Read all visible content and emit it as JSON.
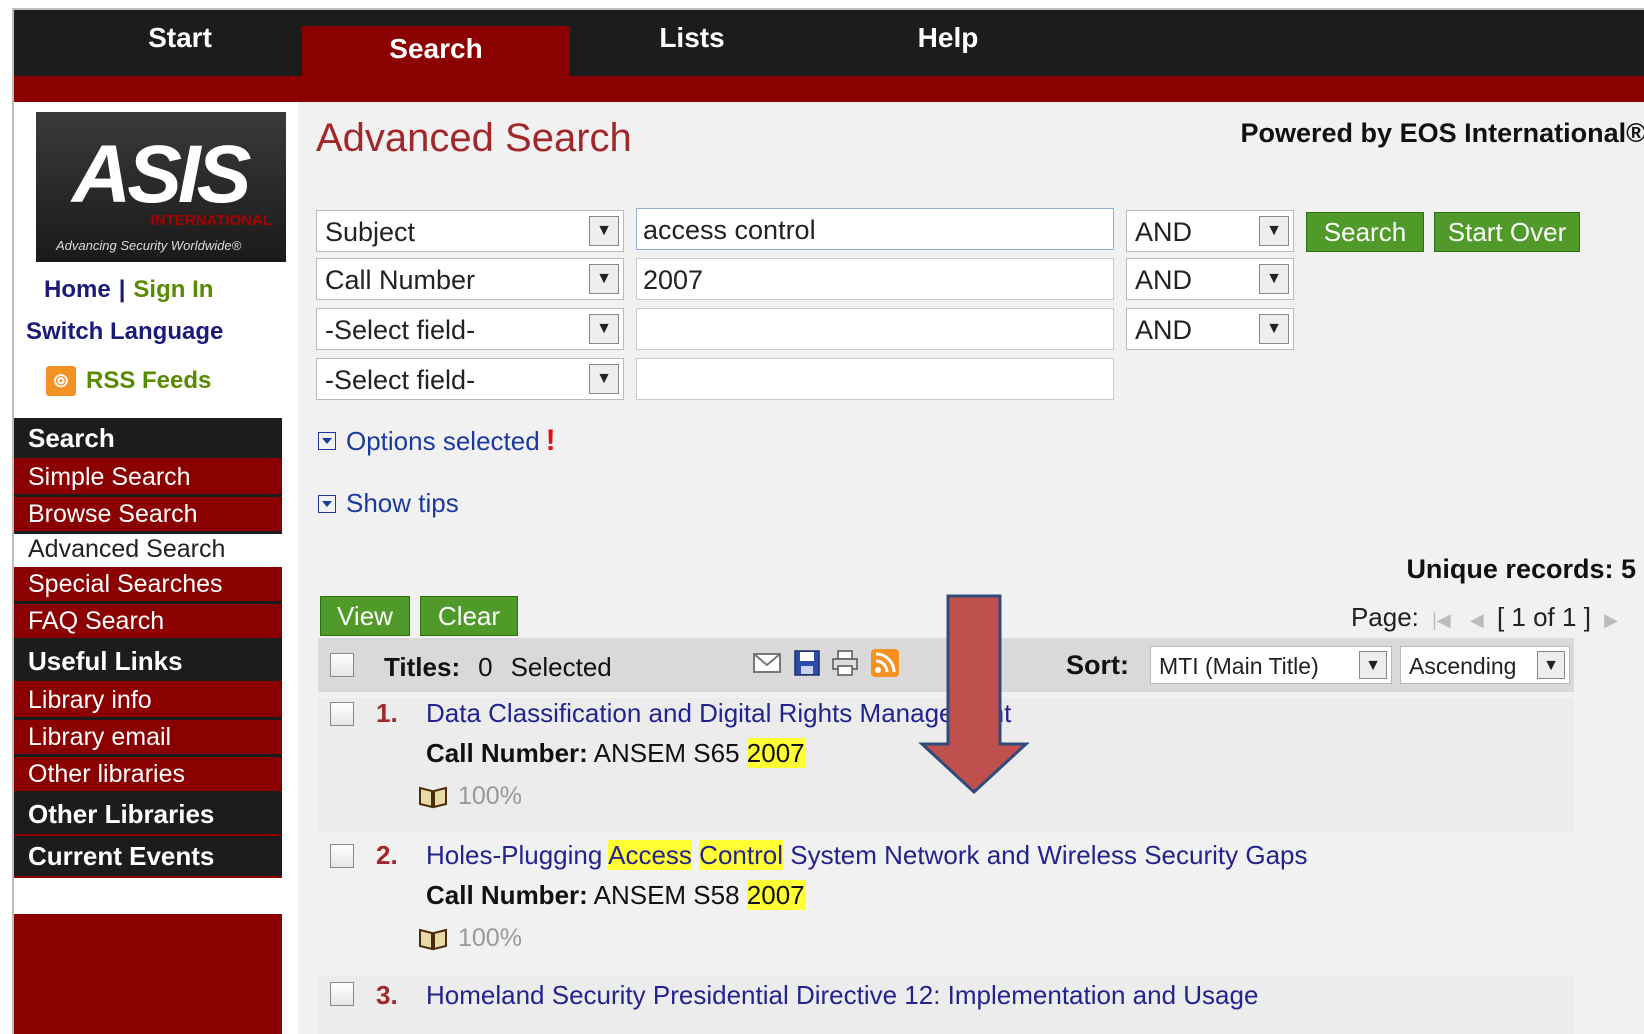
{
  "nav": {
    "tabs": [
      "Start",
      "Search",
      "Lists",
      "Help"
    ],
    "active": "Search"
  },
  "logo": {
    "big": "ASIS",
    "intl": "INTERNATIONAL",
    "tagline": "Advancing Security Worldwide®"
  },
  "sidebar": {
    "home": "Home",
    "sep": "|",
    "signin": "Sign In",
    "switch_language": "Switch Language",
    "rss": "RSS Feeds",
    "search_head": "Search",
    "search_items": [
      "Simple Search",
      "Browse Search",
      "Advanced Search",
      "Special Searches",
      "FAQ Search"
    ],
    "useful_head": "Useful Links",
    "useful_items": [
      "Library info",
      "Library email",
      "Other libraries"
    ],
    "other_libraries": "Other Libraries",
    "current_events": "Current Events"
  },
  "page": {
    "title": "Advanced Search",
    "powered": "Powered by EOS International®"
  },
  "form": {
    "rows": [
      {
        "field": "Subject",
        "value": "access control",
        "op": "AND"
      },
      {
        "field": "Call Number",
        "value": "2007",
        "op": "AND"
      },
      {
        "field": "-Select field-",
        "value": "",
        "op": "AND"
      },
      {
        "field": "-Select field-",
        "value": ""
      }
    ],
    "search_btn": "Search",
    "startover_btn": "Start Over"
  },
  "options": {
    "options_selected": "Options selected",
    "bang": "!",
    "show_tips": "Show tips"
  },
  "results": {
    "unique_label": "Unique records: 5",
    "view_btn": "View",
    "clear_btn": "Clear",
    "page_label": "Page:",
    "page_value": "[ 1 of 1 ]",
    "titles_label": "Titles:",
    "selected_count": "0",
    "selected_label": "Selected",
    "sort_label": "Sort:",
    "sort_field": "MTI (Main Title)",
    "sort_order": "Ascending",
    "call_label": "Call Number:",
    "records": [
      {
        "num": "1.",
        "title": "Data Classification and Digital Rights Management",
        "call_prefix": "ANSEM S65",
        "call_hl": "2007",
        "avail": "100%"
      },
      {
        "num": "2.",
        "title_pre": "Holes-Plugging ",
        "title_hl1": "Access",
        "title_sp": " ",
        "title_hl2": "Control",
        "title_post": " System Network and Wireless Security Gaps",
        "call_prefix": "ANSEM S58",
        "call_hl": "2007",
        "avail": "100%"
      },
      {
        "num": "3.",
        "title": "Homeland Security Presidential Directive 12: Implementation and Usage"
      }
    ]
  },
  "colors": {
    "brand_red": "#8b0000",
    "nav_black": "#1c1c1c",
    "button_green": "#4f9a28",
    "highlight": "#ffff33",
    "arrow_red": "#c0504d"
  }
}
